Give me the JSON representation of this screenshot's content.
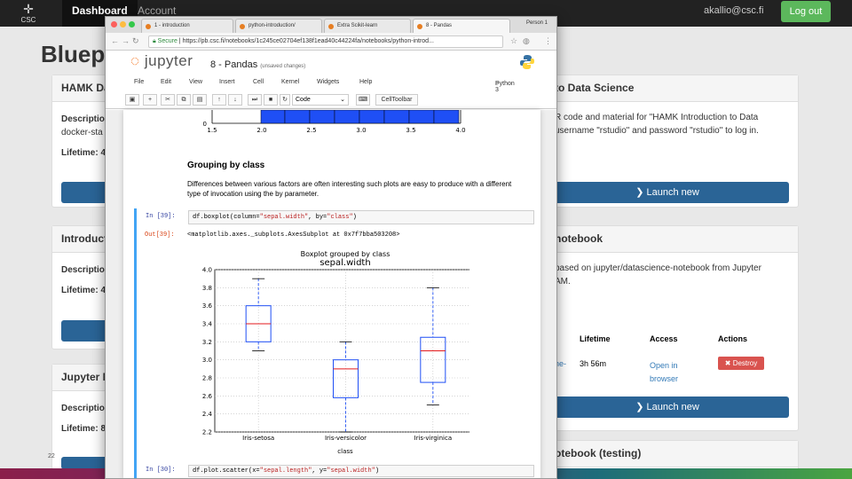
{
  "topnav": {
    "logo_text": "CSC",
    "dashboard_label": "Dashboard",
    "account_label": "Account",
    "user_email": "akallio@csc.fi",
    "logout_label": "Log out"
  },
  "page_title": "Bluep",
  "cards": [
    {
      "head": "HAMK Da",
      "desc_label": "Descriptio",
      "desc_text": "docker-sta",
      "lifetime_label": "Lifetime: 4"
    },
    {
      "head": "Introduct",
      "desc_label": "Descriptio",
      "lifetime_label": "Lifetime: 4"
    },
    {
      "head": "Jupyter N",
      "desc_label": "Descriptio",
      "lifetime_label": "Lifetime: 8"
    },
    {
      "head": "to Data Science",
      "line1": "R code and material for \"HAMK Introduction to Data",
      "line2": "username \"rstudio\" and password \"rstudio\" to log in.",
      "launch_label": "Launch new"
    },
    {
      "head": "notebook",
      "line1": "based on jupyter/datascience-notebook from Jupyter",
      "line2": "AM.",
      "col_lifetime": "Lifetime",
      "col_access": "Access",
      "col_actions": "Actions",
      "row_fragment": "he-",
      "row_lifetime": "3h 56m",
      "row_access_1": "Open in",
      "row_access_2": "browser",
      "destroy_label": "Destroy",
      "launch_label": "Launch new"
    },
    {
      "head": "otebook (testing)"
    }
  ],
  "page_number": "22",
  "browser": {
    "tabs": [
      {
        "label": "1 - introduction",
        "active": false
      },
      {
        "label": "python-introduction/",
        "active": false
      },
      {
        "label": "Extra Scikit-learn",
        "active": false
      },
      {
        "label": "8 - Pandas",
        "active": true
      }
    ],
    "person": "Person 1",
    "url_secure": "Secure",
    "url": "https://pb.csc.fi/notebooks/1c245ce02704ef138f1ead40c44224fa/notebooks/python-introd..."
  },
  "jupyter": {
    "logo": "jupyter",
    "notebook_name": "8 - Pandas",
    "unsaved": "(unsaved changes)",
    "menu": [
      "File",
      "Edit",
      "View",
      "Insert",
      "Cell",
      "Kernel",
      "Widgets",
      "Help"
    ],
    "kernel": "Python 3",
    "cell_type": "Code",
    "celltoolbar_label": "CellToolbar"
  },
  "notebook": {
    "prev_plot_ticks": [
      "1.5",
      "2.0",
      "2.5",
      "3.0",
      "3.5",
      "4.0"
    ],
    "prev_plot_zero": "0",
    "heading": "Grouping by class",
    "paragraph": "Differences between various factors are often interesting such plots are easy to produce with a different type of invocation using the by parameter.",
    "in_prompt": "In [39]:",
    "code_pre": "df.boxplot(column=",
    "code_arg1": "\"sepal.width\"",
    "code_mid": ", by=",
    "code_arg2": "\"class\"",
    "code_post": ")",
    "out_prompt": "Out[39]:",
    "out_text": "<matplotlib.axes._subplots.AxesSubplot at 0x7f7bba503208>",
    "in_prompt2": "In [30]:",
    "code2_pre": "df.plot.scatter(x=",
    "code2_arg1": "\"sepal.length\"",
    "code2_mid": ", y=",
    "code2_arg2": "\"sepal.width\"",
    "code2_post": ")"
  },
  "chart_data": {
    "type": "box",
    "suptitle": "Boxplot grouped by class",
    "title": "sepal.width",
    "xlabel": "class",
    "categories": [
      "Iris-setosa",
      "Iris-versicolor",
      "Iris-virginica"
    ],
    "ylim": [
      2.2,
      4.0
    ],
    "yticks": [
      "2.2",
      "2.4",
      "2.6",
      "2.8",
      "3.0",
      "3.2",
      "3.4",
      "3.6",
      "3.8",
      "4.0"
    ],
    "boxes": [
      {
        "whisker_low": 3.1,
        "q1": 3.2,
        "median": 3.4,
        "q3": 3.6,
        "whisker_high": 3.9
      },
      {
        "whisker_low": 2.2,
        "q1": 2.58,
        "median": 2.9,
        "q3": 3.0,
        "whisker_high": 3.2
      },
      {
        "whisker_low": 2.5,
        "q1": 2.75,
        "median": 3.1,
        "q3": 3.25,
        "whisker_high": 3.8
      }
    ]
  }
}
